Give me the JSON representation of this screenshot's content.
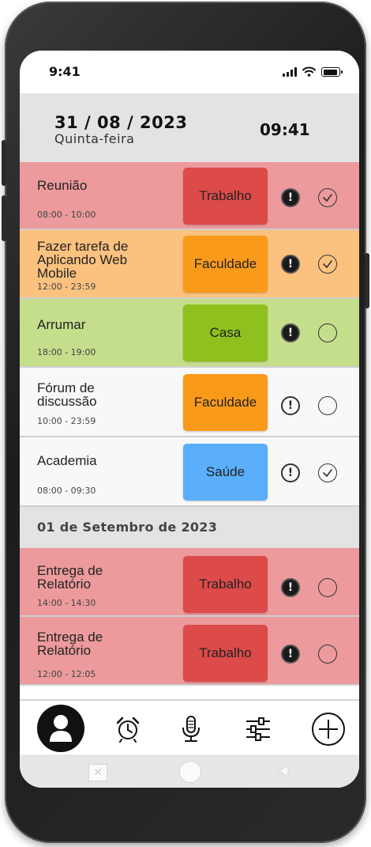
{
  "status_bar": {
    "time": "9:41"
  },
  "header": {
    "date": "31 / 08 / 2023",
    "weekday": "Quinta-feira",
    "clock": "09:41"
  },
  "tasks_today": [
    {
      "title": "Reunião",
      "hours": "08:00 - 10:00",
      "tag": "Trabalho",
      "bg": "#ec9a9c",
      "tag_color": "#dd4a4a",
      "priority": true,
      "done": true
    },
    {
      "title": "Fazer tarefa de Aplicando Web Mobile",
      "hours": "12:00 - 23:59",
      "tag": "Faculdade",
      "bg": "#fbc17f",
      "tag_color": "#f99a1b",
      "priority": true,
      "done": true
    },
    {
      "title": "Arrumar",
      "hours": "18:00 - 19:00",
      "tag": "Casa",
      "bg": "#c5de8c",
      "tag_color": "#8ec01e",
      "priority": true,
      "done": false
    },
    {
      "title": "Fórum de discussão",
      "hours": "10:00 - 23:59",
      "tag": "Faculdade",
      "bg": "#f8f8f8",
      "tag_color": "#f99a1b",
      "priority": false,
      "done": false
    },
    {
      "title": "Academia",
      "hours": "08:00 - 09:30",
      "tag": "Saúde",
      "bg": "#f8f8f8",
      "tag_color": "#5aaefa",
      "priority": false,
      "done": true
    }
  ],
  "section_label": "01 de Setembro de 2023",
  "tasks_next": [
    {
      "title": "Entrega de Relatório",
      "hours": "14:00 - 14:30",
      "tag": "Trabalho",
      "bg": "#ec9a9c",
      "tag_color": "#dd4a4a",
      "priority": true,
      "done": false
    },
    {
      "title": "Entrega de Relatório",
      "hours": "12:00 - 12:05",
      "tag": "Trabalho",
      "bg": "#ec9a9c",
      "tag_color": "#dd4a4a",
      "priority": true,
      "done": false
    }
  ],
  "nav": {
    "items": [
      {
        "icon": "profile-icon"
      },
      {
        "icon": "alarm-clock-icon"
      },
      {
        "icon": "microphone-icon"
      },
      {
        "icon": "sliders-icon"
      },
      {
        "icon": "add-icon"
      }
    ]
  },
  "icons": {
    "priority": "exclamation-icon",
    "done": "checkmark-icon"
  }
}
